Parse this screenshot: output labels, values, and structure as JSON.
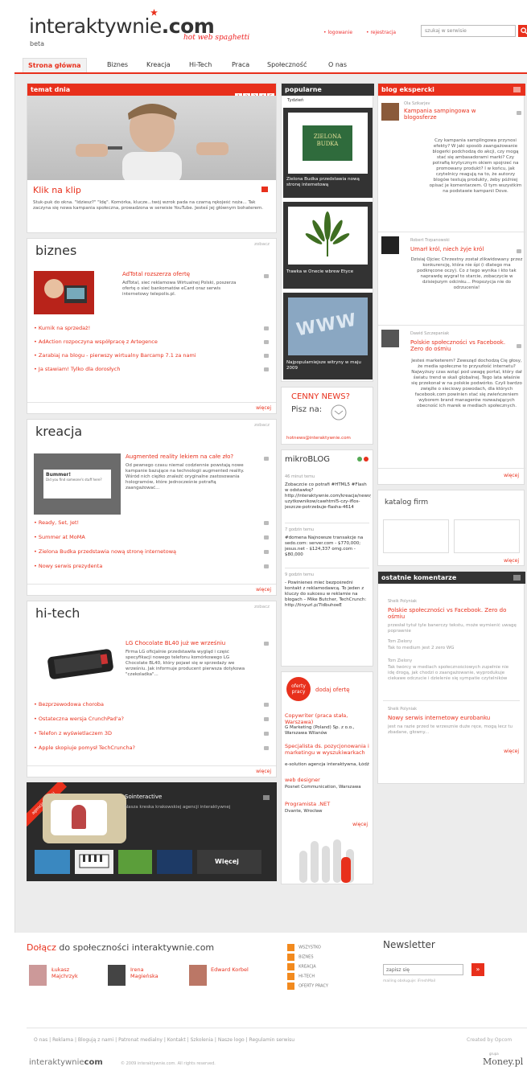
{
  "header": {
    "logo_text": "interaktywnie",
    "logo_tld": ".com",
    "beta": "beta",
    "slogan": "hot web spaghetti",
    "login": "logowanie",
    "register": "rejestracja",
    "search_placeholder": "szukaj w serwisie",
    "accent": "#e8301c"
  },
  "nav": {
    "tabs": [
      "Strona główna",
      "Biznes",
      "Kreacja",
      "Hi-Tech",
      "Praca",
      "Społeczność",
      "O nas"
    ]
  },
  "temat": {
    "bar": "temat dnia",
    "pages": [
      "1",
      "2",
      "3",
      "4",
      "5"
    ],
    "title": "Klik na klip",
    "text": "Stuk-puk do okna. \"Idziesz?\" \"Idę\". Komórka, klucze...twój wzrok pada na czarną rękojeść noża... Tak zaczyna się nowa kampania społeczna, prowadzona w serwisie YouTube. Jesteś jej głównym bohaterem."
  },
  "biznes": {
    "title": "biznes",
    "corner": "zobacz",
    "lead_title": "AdTotal rozszerza ofertę",
    "lead_text": "AdTotal, sieć reklamowa Wirtualnej Polski, poszerza ofertę o sieć bankomatów eCard oraz serwis internetowy telepolis.pl.",
    "links": [
      "Kurnik na sprzedaż!",
      "AdAction rozpoczyna współpracę z Artegence",
      "Zarabiaj na blogu - pierwszy wirtualny Barcamp 7.1 za nami",
      "Ja stawiam! Tylko dla dorosłych"
    ],
    "more": "więcej"
  },
  "kreacja": {
    "title": "kreacja",
    "corner": "zobacz",
    "thumb_title": "Bummer!",
    "thumb_text": "Did you find someone's stuff here?",
    "lead_title": "Augmented reality lekiem na całe zło?",
    "lead_text": "Od pewnego czasu niemal codziennie powstają nowe kampanie bazujące na technologii augmented reality. Wśród nich ciężko znaleźć oryginalne zastosowania hologramów, które jednocześnie potrafią zaangażować...",
    "links": [
      "Ready, Set, Jet!",
      "Summer at MoMA",
      "Zielona Budka przedstawia nową stronę internetową",
      "Nowy serwis prezydenta"
    ],
    "more": "więcej"
  },
  "hitech": {
    "title": "hi-tech",
    "corner": "zobacz",
    "lead_title": "LG Chocolate BL40 już we wrześniu",
    "lead_text": "Firma LG oficjalnie przedstawiła wygląd i część specyfikacji nowego telefonu komórkowego LG Chocolate BL40, który pojawi się w sprzedaży we wrześniu. Jak informuje producent pierwsza dotykowa \"czekoladka\"...",
    "links": [
      "Bezprzewodowa choroba",
      "Ostateczna wersja CrunchPad'a?",
      "Telefon z wyświetlaczem 3D",
      "Apple skopiuje pomysł TechCruncha?"
    ],
    "more": "więcej"
  },
  "agency": {
    "ribbon": "agencja okresu",
    "name": "Sointeractive",
    "text": "Nasza kreska krakowskiej agencji interaktywnej",
    "more": "Więcej"
  },
  "popular": {
    "bar": "popularne",
    "tab": "Tydzień",
    "items": [
      {
        "img": "ZIELONA BUDKA",
        "cap": "Zielona Budka przedstawia nową stronę internetową"
      },
      {
        "img": "",
        "cap": "Trawka w Onecie wbrew Etyce"
      },
      {
        "img": "WWW",
        "cap": "Najpopularniejsze witryny w maju 2009"
      }
    ]
  },
  "cenny": {
    "title": "CENNY NEWS?",
    "sub": "Pisz na:",
    "email": "hotnews@interaktywnie.com"
  },
  "microblog": {
    "title": "mikroBLOG",
    "entries": [
      {
        "time": "46 minut temu",
        "text": "Zobaczcie co potrafi #HTML5 #Flash w odstawkę? http://interaktywnie.com/kreacja/newsy-uzytkownikow/cawhtml5-czy-iflos-jeszcze-potrzebuje-flasha-4614"
      },
      {
        "time": "7 godzin temu",
        "text": "#domena Najnowsze transakcje na sedo.com: server.com - $770,000; jesus.net - $124,337 omg.com - $80,000"
      },
      {
        "time": "9 godzin temu",
        "text": "- Powinieneś mieć bezpośredni kontakt z reklamodawcą. To jeden z kluczy do sukcesu w reklamie na blogach – Mike Butcher, TechCrunch: http://tinyurl.p/7ldbuhoeE"
      }
    ]
  },
  "jobs": {
    "badge": "oferty pracy",
    "add": "dodaj ofertę",
    "items": [
      {
        "title": "Copywriter (praca stała, Warszawa)",
        "company": "G Marketing (Poland) Sp. z o.o., Warszawa Wilanów"
      },
      {
        "title": "Specjalista ds. pozycjonowania i marketingu w wyszukiwarkach",
        "company": "e-solution agencja interaktywna, Łódź"
      },
      {
        "title": "web designer",
        "company": "Posnet Communication, Warszawa"
      },
      {
        "title": "Programista .NET",
        "company": "Dvante, Wrocław"
      }
    ],
    "more": "więcej"
  },
  "blog": {
    "bar": "blog ekspercki",
    "entries": [
      {
        "author": "Ola Szikarjev",
        "title": "Kampania sampingowa w blogosferze",
        "text": "Czy kampania samplingowa przynosi efekty? W jaki sposób zaangażowanie blogerki podchodzą do akcji, czy mogą stać się ambasadorami marki? Czy potrafią krytycznym okiem spojrzeć na promowany produkt? I w końcu, jak czytelnicy reagują na to, że autorzy blogów testują produkty, żeby później opisać je komentarzem. O tym wszystkim na podstawie kampanii Dove."
      },
      {
        "author": "Robert Trzpanowski",
        "title": "Umarł król, niech żyje król",
        "text": "Dzisiaj Ojciec Chrzestny został zlikwidowany przez konkurencję, która nie śpi (i dlatego ma podkręcone oczy). Co z tego wynika i kto tak naprawdę wygrał to starcie, zobaczycie w dzisiejszym odcinku... Propozycja nie do odrzucenia!"
      },
      {
        "author": "Dawid Szczepaniak",
        "title": "Polskie społeczności vs Facebook. Zero do ośmiu",
        "text": "Jesteś marketerem? Zewsząd dochodzą Cię głosy, że media społeczne to przyszłość internetu? Najwyższy czas wziąć pod uwagę portal, który dał światu trend w skali globalnej. Tego lata właśnie się przekonał w na polskie podwórko. Czyli bardzo zwięźle o sieciowy powodach, dla których facebook.com powinien stać się zwieńczeniem wyborem brand managerów rozważających obecność ich marek w mediach społecznych."
      }
    ],
    "more": "więcej"
  },
  "katalog": {
    "title": "katalog firm",
    "more": "więcej"
  },
  "comments": {
    "bar": "ostatnie komentarze",
    "entries": [
      {
        "author": "Sheik Polyniak",
        "title": "Polskie społeczności vs Facebook. Zero do ośmiu",
        "text": "przesłał tytuł tyle banerczy tekstu, może wymienić uwagę poprawnie"
      },
      {
        "author": "Tom Zielony",
        "title": "",
        "text": "Tak to medium jest 2 zero WG"
      },
      {
        "author": "Tom Zielony",
        "title": "",
        "text": "Tak twórcy w mediach społecznościowych zupełnie nie idę drogą, jak chodzi o zaangażowanie, wyprodukuje ciekawe odczucie i dzielenie się sympatie czytelników"
      },
      {
        "author": "Sheik Polyniak",
        "title": "Nowy serwis internetowy eurobanku",
        "text": "jest na razie przed te wrzesznie duże ręce, mogą lecz tu zbadane, głowny..."
      }
    ],
    "more": "więcej"
  },
  "join": {
    "title_a": "Dołącz",
    "title_b": "do społeczności interaktywnie.com",
    "members": [
      "Łukasz Majchrzyk",
      "Irena Magieńska",
      "Edward Korbel"
    ]
  },
  "rss": {
    "items": [
      "WSZYSTKO",
      "BIZNES",
      "KREACJA",
      "HI-TECH",
      "OFERTY PRACY"
    ]
  },
  "newsletter": {
    "title": "Newsletter",
    "placeholder": "zapisz się",
    "note": "mailing obsługuje: iFreshMail"
  },
  "footer": {
    "links": [
      "O nas",
      "Reklama",
      "Blogują z nami",
      "Patronat medialny",
      "Kontakt",
      "Szkolenia",
      "Nasze logo",
      "Regulamin serwisu"
    ],
    "credit": "Created by Opcom",
    "copyright": "© 2009 interaktywnie.com. All rights reserved.",
    "logo_text": "interaktywnie",
    "logo_tld": "com",
    "group": "grupa",
    "group_name": "Money.pl"
  }
}
